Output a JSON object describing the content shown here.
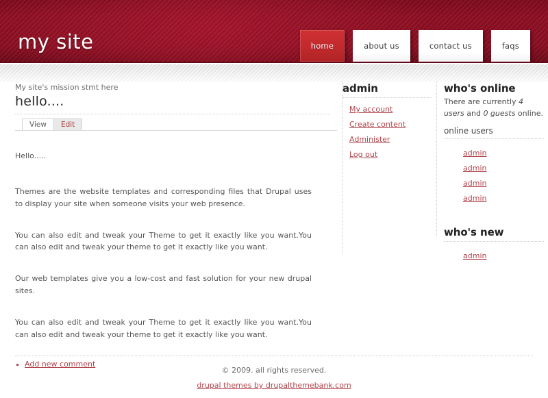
{
  "banner": {
    "logo": "my site",
    "brand_color": "#8b0f22",
    "accent_color": "#c0282d",
    "nav": [
      {
        "label": "home",
        "active": true
      },
      {
        "label": "about us",
        "active": false
      },
      {
        "label": "contact us",
        "active": false
      },
      {
        "label": "faqs",
        "active": false
      }
    ]
  },
  "main": {
    "mission": "My site's mission stmt here",
    "title": "hello....",
    "tabs": [
      {
        "label": "View",
        "active": true
      },
      {
        "label": "Edit",
        "active": false
      }
    ],
    "paragraphs": [
      "Hello.....",
      "Themes are the website templates and corresponding files that Drupal uses to display your site when someone visits your web presence.",
      "You can also edit and tweak your Theme to get it exactly like you want.You can also edit and tweak your theme to get it exactly like you want.",
      "Our web templates give you a low-cost and fast solution for your new drupal sites.",
      "You can also edit and tweak your Theme to get it exactly like you want.You can also edit and tweak your theme to get it exactly like you want."
    ],
    "comment_link": "Add new comment"
  },
  "admin_block": {
    "title": "admin",
    "items": [
      {
        "label": "My account"
      },
      {
        "label": "Create content"
      },
      {
        "label": "Administer"
      },
      {
        "label": "Log out"
      }
    ]
  },
  "whos_online": {
    "title": "who's online",
    "summary_prefix": "There are currently ",
    "user_count": "4 users",
    "summary_middle": " and ",
    "guest_count": "0 guests",
    "summary_suffix": " online.",
    "subtitle": "online users",
    "users": [
      {
        "name": "admin"
      },
      {
        "name": "admin"
      },
      {
        "name": "admin"
      },
      {
        "name": "admin"
      }
    ]
  },
  "whos_new": {
    "title": "who's new",
    "users": [
      {
        "name": "admin"
      }
    ]
  },
  "footer": {
    "copyright": "© 2009. all rights reserved.",
    "credit_link": "drupal themes by drupalthemebank.com"
  }
}
